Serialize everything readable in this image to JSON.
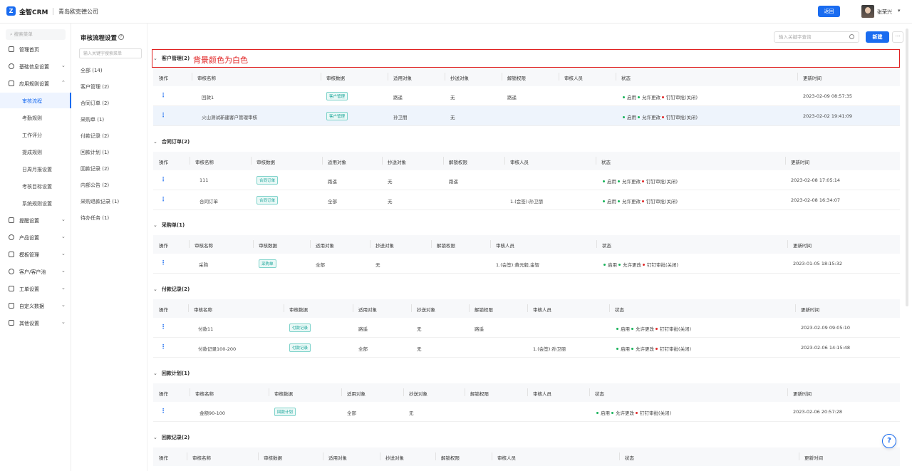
{
  "header": {
    "logo_letter": "Z",
    "brand": "金智CRM",
    "company": "青岛欧克德公司",
    "back_label": "返回",
    "user_name": "张荣兴"
  },
  "leftnav": {
    "search_placeholder": "搜索菜单",
    "items": [
      {
        "label": "管理首页",
        "icon": "home-icon"
      },
      {
        "label": "基础信息设置",
        "icon": "settings-icon"
      },
      {
        "label": "应用规则设置",
        "icon": "rules-icon"
      },
      {
        "label": "提醒设置",
        "icon": "bell-icon"
      },
      {
        "label": "产品设置",
        "icon": "box-icon"
      },
      {
        "label": "模板管理",
        "icon": "template-icon"
      },
      {
        "label": "客户/客户池",
        "icon": "users-icon"
      },
      {
        "label": "工单设置",
        "icon": "ticket-icon"
      },
      {
        "label": "自定义数据",
        "icon": "custom-data-icon"
      },
      {
        "label": "其他设置",
        "icon": "grid-icon"
      }
    ],
    "subitems": [
      "审核流程",
      "考勤规则",
      "工作评分",
      "提成规则",
      "日周月报设置",
      "考核目标设置",
      "系统规则设置"
    ]
  },
  "col2": {
    "title": "审核流程设置",
    "search_placeholder": "输入关键字搜索菜单",
    "categories": [
      "全部 (14)",
      "客户管理 (2)",
      "合同订单 (2)",
      "采购单 (1)",
      "付款记录 (2)",
      "回款计划 (1)",
      "回款记录 (2)",
      "内部公告 (2)",
      "采购退款记录 (1)",
      "待办任务 (1)"
    ]
  },
  "main": {
    "search_placeholder": "输入关键字查询",
    "new_label": "新建",
    "more_label": "···",
    "annotation": "背景颜色为白色",
    "columns": {
      "op": "操作",
      "name": "审核名称",
      "data": "审核数据",
      "target": "适用对象",
      "cc": "抄送对象",
      "unlock": "解锁权限",
      "approver": "审核人员",
      "status": "状态",
      "updated": "更新时间"
    },
    "status": {
      "enable": "启用",
      "allow_edit": "允许更改",
      "dingtalk": "钉钉审批(关闭)"
    },
    "sections": [
      {
        "title": "客户管理(2)",
        "rows": [
          {
            "name": "回款1",
            "tag": "客户管理",
            "target": "路遥",
            "cc": "无",
            "unlock": "路遥",
            "approver": "",
            "updated": "2023-02-09 08:57:35"
          },
          {
            "name": "火山测试新建客户管理审核",
            "tag": "客户管理",
            "target": "孙卫朋",
            "cc": "无",
            "unlock": "",
            "approver": "",
            "updated": "2023-02-02 19:41:09"
          }
        ]
      },
      {
        "title": "合同订单(2)",
        "rows": [
          {
            "name": "111",
            "tag": "合同订单",
            "target": "路遥",
            "cc": "无",
            "unlock": "路遥",
            "approver": "",
            "updated": "2023-02-08 17:05:14"
          },
          {
            "name": "合同订单",
            "tag": "合同订单",
            "target": "全部",
            "cc": "无",
            "unlock": "",
            "approver": "1.(会签):孙卫朋",
            "updated": "2023-02-08 16:34:07"
          }
        ]
      },
      {
        "title": "采购单(1)",
        "rows": [
          {
            "name": "采购",
            "tag": "采购单",
            "target": "全部",
            "cc": "无",
            "unlock": "",
            "approver": "1.(会签):黄元毅,金智",
            "updated": "2023-01-05 18:15:32"
          }
        ]
      },
      {
        "title": "付款记录(2)",
        "rows": [
          {
            "name": "付款11",
            "tag": "付款记录",
            "target": "路遥",
            "cc": "无",
            "unlock": "路遥",
            "approver": "",
            "updated": "2023-02-09 09:05:10"
          },
          {
            "name": "付款记录100-200",
            "tag": "付款记录",
            "target": "全部",
            "cc": "无",
            "unlock": "",
            "approver": "1.(会签):孙卫朋",
            "updated": "2023-02-06 14:15:48"
          }
        ]
      },
      {
        "title": "回款计划(1)",
        "rows": [
          {
            "name": "金额90-100",
            "tag": "回款计划",
            "target": "全部",
            "cc": "无",
            "unlock": "",
            "approver": "",
            "updated": "2023-02-06 20:57:28"
          }
        ]
      },
      {
        "title": "回款记录(2)",
        "rows": []
      }
    ]
  },
  "colors": {
    "primary": "#1a6cf0",
    "annotation": "#e02020",
    "tag": "#1aa59a",
    "ok": "#19b35b",
    "off": "#e02a2a"
  }
}
